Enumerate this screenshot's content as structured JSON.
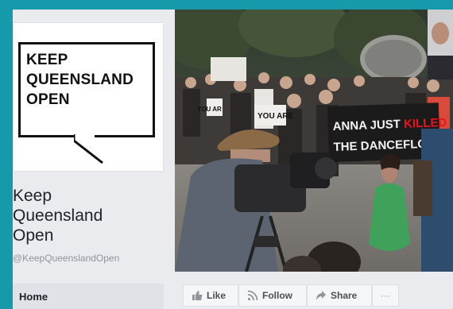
{
  "logo": {
    "line1": "KEEP",
    "line2": "QUEENSLAND",
    "line3": "OPEN"
  },
  "page": {
    "name_line1": "Keep",
    "name_line2": "Queensland",
    "name_line3": "Open",
    "handle": "@KeepQueenslandOpen"
  },
  "nav": {
    "home_label": "Home"
  },
  "cover": {
    "banner_line1": "ANNA JUST ",
    "banner_highlight": "KILLED",
    "banner_line2": "THE DANCEFLOOR",
    "sign_small_1": "YOU ARE",
    "sign_small_2": "YOU AR"
  },
  "actions": {
    "like_label": "Like",
    "follow_label": "Follow",
    "share_label": "Share",
    "more_label": "···"
  },
  "colors": {
    "frame": "#1699ab",
    "banner_highlight": "#e8141c"
  }
}
